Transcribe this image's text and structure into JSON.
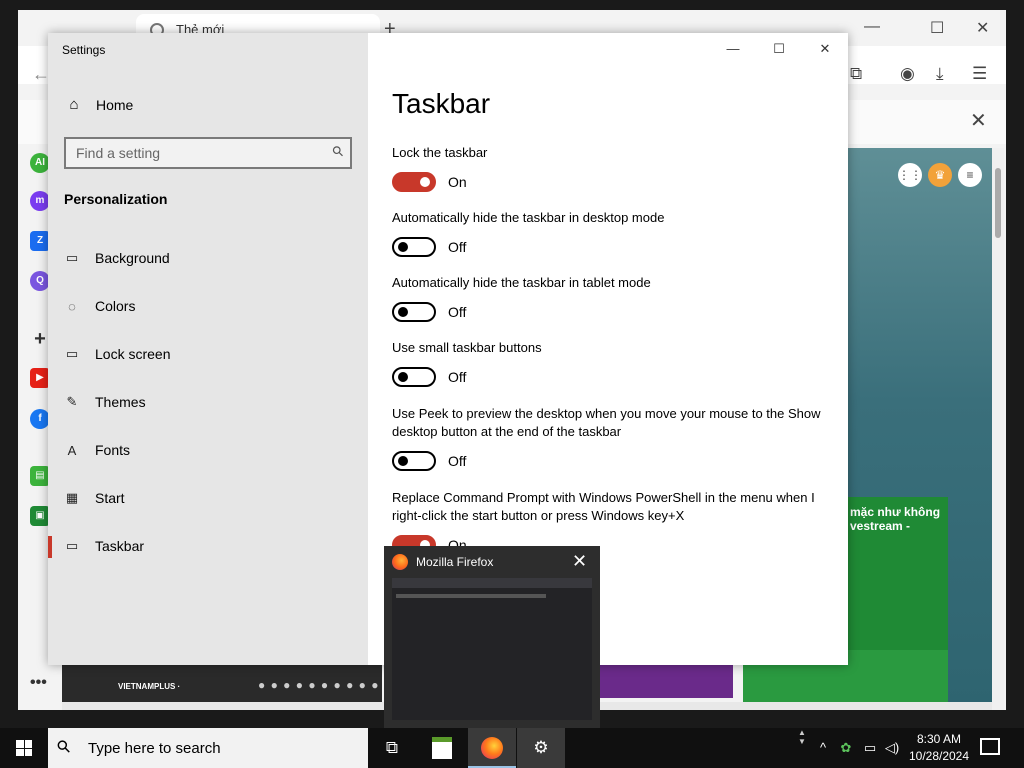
{
  "browser": {
    "tab_title": "Thẻ mới",
    "news_logo": "VIETNAMPLUS ·",
    "card_text": "mặc như không\nvestream -"
  },
  "settings": {
    "app_title": "Settings",
    "window_controls": {
      "minimize": "—",
      "maximize": "☐",
      "close": "✕"
    },
    "home_label": "Home",
    "search_placeholder": "Find a setting",
    "section_title": "Personalization",
    "nav_items": [
      {
        "label": "Background",
        "icon": "picture-icon"
      },
      {
        "label": "Colors",
        "icon": "palette-icon"
      },
      {
        "label": "Lock screen",
        "icon": "lock-screen-icon"
      },
      {
        "label": "Themes",
        "icon": "themes-icon"
      },
      {
        "label": "Fonts",
        "icon": "fonts-icon"
      },
      {
        "label": "Start",
        "icon": "start-icon"
      },
      {
        "label": "Taskbar",
        "icon": "taskbar-icon",
        "selected": true
      }
    ],
    "page_title": "Taskbar",
    "options": [
      {
        "label": "Lock the taskbar",
        "state": "On"
      },
      {
        "label": "Automatically hide the taskbar in desktop mode",
        "state": "Off"
      },
      {
        "label": "Automatically hide the taskbar in tablet mode",
        "state": "Off"
      },
      {
        "label": "Use small taskbar buttons",
        "state": "Off"
      },
      {
        "label": "Use Peek to preview the desktop when you move your mouse to the Show desktop button at the end of the taskbar",
        "state": "Off"
      },
      {
        "label": "Replace Command Prompt with Windows PowerShell in the menu when I right-click the start button or press Windows key+X",
        "state": "On"
      }
    ],
    "accent_color": "#c8382a"
  },
  "preview": {
    "title": "Mozilla Firefox",
    "close": "✕"
  },
  "taskbar": {
    "search_placeholder": "Type here to search",
    "time": "8:30 AM",
    "date": "10/28/2024"
  }
}
